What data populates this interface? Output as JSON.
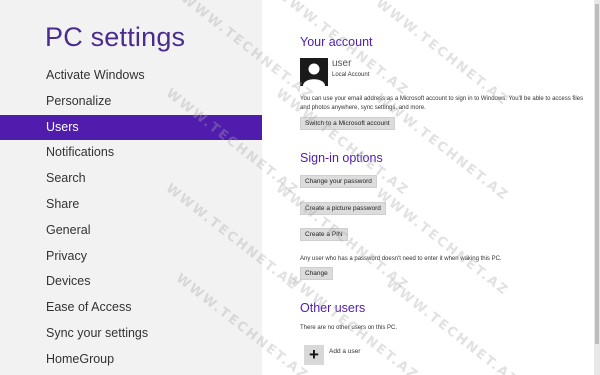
{
  "left": {
    "title": "PC settings",
    "nav_items": [
      {
        "label": "Activate Windows"
      },
      {
        "label": "Personalize"
      },
      {
        "label": "Users"
      },
      {
        "label": "Notifications"
      },
      {
        "label": "Search"
      },
      {
        "label": "Share"
      },
      {
        "label": "General"
      },
      {
        "label": "Privacy"
      },
      {
        "label": "Devices"
      },
      {
        "label": "Ease of Access"
      },
      {
        "label": "Sync your settings"
      },
      {
        "label": "HomeGroup"
      }
    ],
    "selected": "Users"
  },
  "account": {
    "section_title": "Your account",
    "user_name": "user",
    "account_type": "Local Account",
    "description": "You can use your email address as a Microsoft account to sign in to Windows. You'll be able to access files and photos anywhere, sync settings, and more.",
    "switch_button": "Switch to a Microsoft account"
  },
  "signin": {
    "section_title": "Sign-in options",
    "change_password_button": "Change your password",
    "picture_password_button": "Create a picture password",
    "pin_button": "Create a PIN",
    "wake_text": "Any user who has a password doesn't need to enter it when waking this PC.",
    "change_button": "Change"
  },
  "other_users": {
    "section_title": "Other users",
    "empty_text": "There are no other users on this PC.",
    "add_icon": "+",
    "add_label": "Add a user"
  },
  "watermark": "WWW.TECHNET.AZ",
  "colors": {
    "accent": "#4f1cae",
    "title": "#4b2c8e",
    "left_background": "#f2f2f2"
  }
}
